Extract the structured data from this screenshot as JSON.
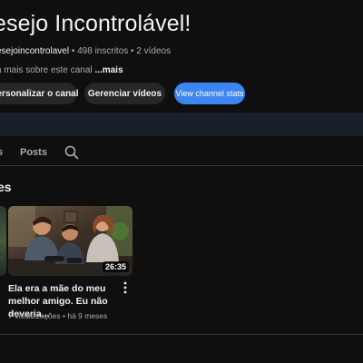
{
  "channel": {
    "title": "esejo Incontrolável!",
    "handle": "esejoincontrolavel",
    "stats": " • 498 inscritos • 2 vídeos",
    "about": "a mais sobre este canal ",
    "about_more": "...mais"
  },
  "buttons": {
    "customize": "ersonalizar o canal",
    "manage": "Gerenciar vídeos",
    "stats": "View channel stats"
  },
  "tabs": {
    "partial": "s",
    "posts": "Posts"
  },
  "section": {
    "title": "es"
  },
  "video": {
    "duration": "26:35",
    "title": "Ela era a mãe do meu melhor amigo. Eu não deveria...",
    "meta": "7 visualizações • há 9 meses"
  },
  "colors": {
    "background": "#0f0f0f",
    "accent_button": "#3e86ef",
    "secondary_button": "#272727"
  },
  "icons": [
    "search-icon",
    "more-vert-icon"
  ]
}
